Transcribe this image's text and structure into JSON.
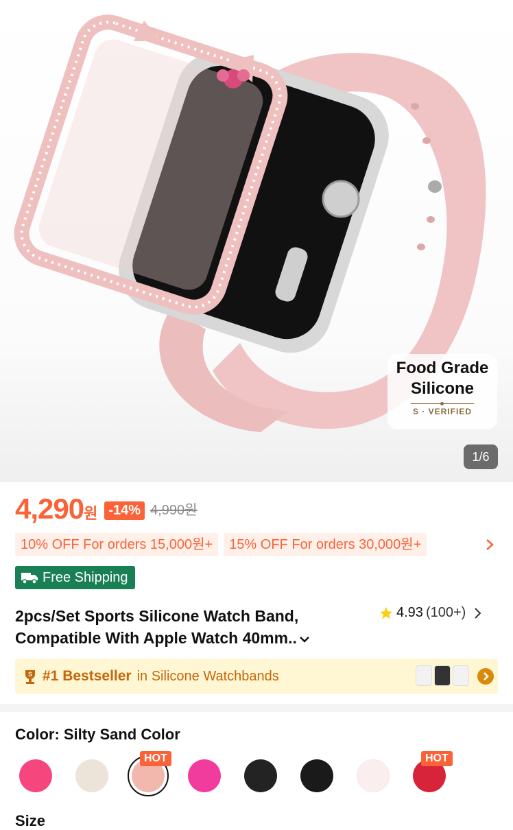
{
  "gallery": {
    "counter": "1/6",
    "badge_line1": "Food Grade",
    "badge_line2": "Silicone",
    "badge_verified": "S · VERIFIED"
  },
  "price": {
    "value": "4,290",
    "currency": "원",
    "discount": "-14%",
    "original": "4,990원"
  },
  "coupons": [
    "10% OFF For orders 15,000원+",
    "15% OFF For orders 30,000원+"
  ],
  "shipping": {
    "label": "Free Shipping"
  },
  "product": {
    "title_line1": "2pcs/Set Sports Silicone Watch Band,",
    "title_line2": "Compatible With Apple Watch 40mm..",
    "rating": "4.93",
    "review_count": "(100+)"
  },
  "bestseller": {
    "badge": "#1 Bestseller",
    "category": "in Silicone Watchbands"
  },
  "color": {
    "label": "Color: Silty Sand Color",
    "hot_tag": "HOT",
    "swatches": [
      "#f5467e",
      "#ece4d8",
      "#f2b8ae",
      "#f23c9d",
      "#232323",
      "#1a1a1a",
      "#faeeee",
      "#d8243a"
    ]
  },
  "size": {
    "label": "Size"
  },
  "colors": {
    "accent": "#fa6338",
    "shipping_green": "#198055",
    "bestseller_bg": "#fff7d4"
  }
}
